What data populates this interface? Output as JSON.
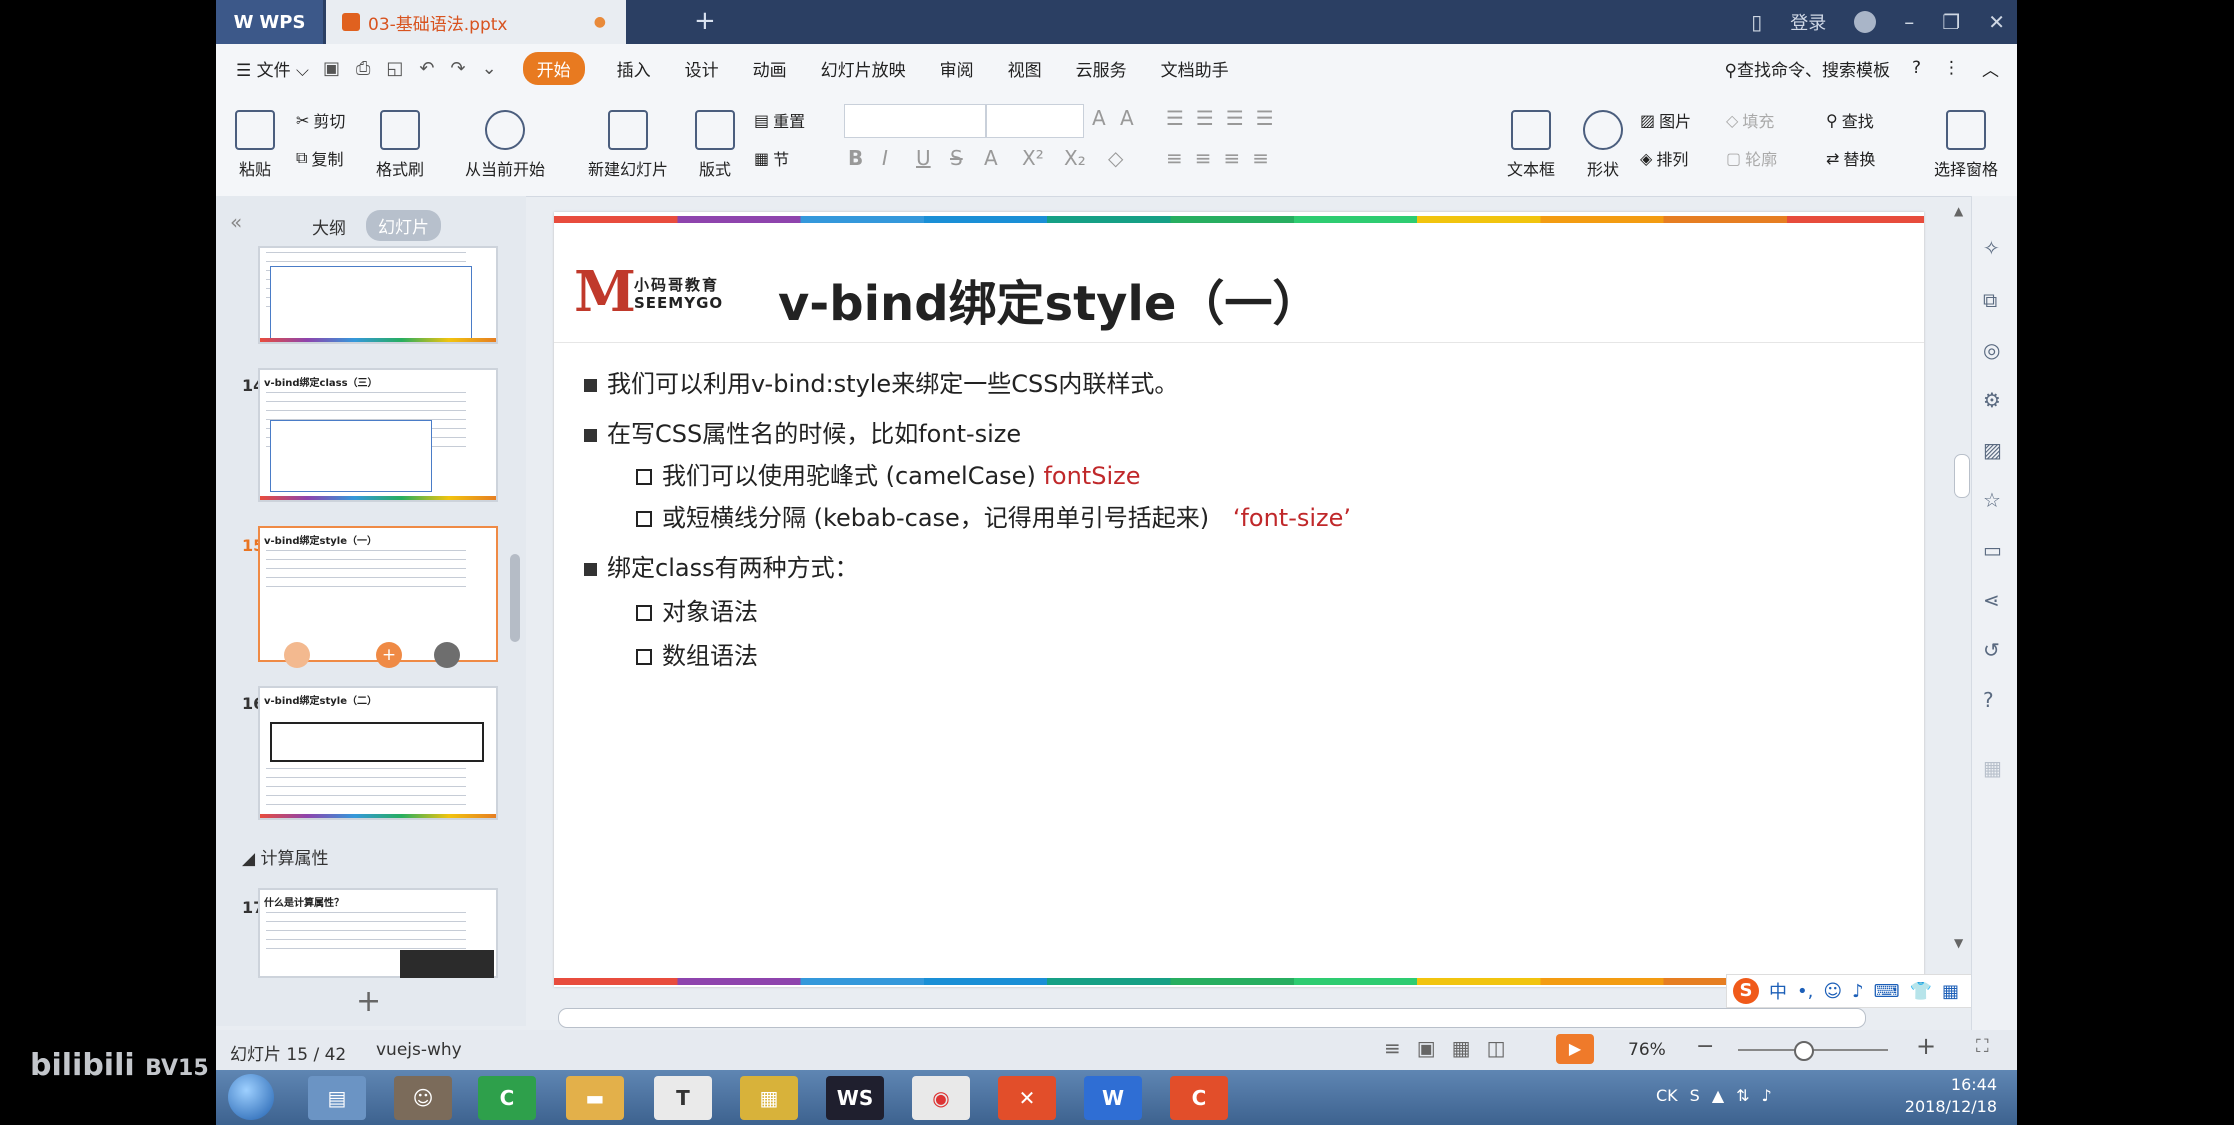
{
  "titlebar": {
    "wps_label": "WPS",
    "doc_tab": "03-基础语法.pptx",
    "login": "登录",
    "new_tab": "+"
  },
  "menu": {
    "file": "文件",
    "items": [
      "开始",
      "插入",
      "设计",
      "动画",
      "幻灯片放映",
      "审阅",
      "视图",
      "云服务",
      "文档助手"
    ],
    "search": "查找命令、搜索模板",
    "help": "?"
  },
  "ribbon": {
    "paste": "粘贴",
    "cut": "剪切",
    "copy": "复制",
    "format_painter": "格式刷",
    "play_from_current": "从当前开始",
    "new_slide": "新建幻灯片",
    "layout": "版式",
    "reset": "重置",
    "section": "节",
    "textbox": "文本框",
    "shape": "形状",
    "picture": "图片",
    "arrange": "排列",
    "fill": "填充",
    "outline": "轮廓",
    "find": "查找",
    "replace": "替换",
    "select_pane": "选择窗格"
  },
  "nav": {
    "tab_outline": "大纲",
    "tab_slides": "幻灯片",
    "thumbs": [
      {
        "num": "14",
        "title": "v-bind绑定class（三）"
      },
      {
        "num": "15",
        "title": "v-bind绑定style（一）"
      },
      {
        "num": "16",
        "title": "v-bind绑定style（二）"
      },
      {
        "num": "17",
        "title": "什么是计算属性？"
      }
    ],
    "section_title": "计算属性",
    "add": "+"
  },
  "slide": {
    "logo_cn": "小码哥教育",
    "logo_en": "SEEMYGO",
    "title": "v-bind绑定style（一）",
    "b1": "我们可以利用v-bind:style来绑定一些CSS内联样式。",
    "b2": "在写CSS属性名的时候，比如font-size",
    "b2_1": "我们可以使用驼峰式 (camelCase)",
    "b2_1_red": "fontSize",
    "b2_2": "或短横线分隔 (kebab-case，记得用单引号括起来)",
    "b2_2_red": "‘font-size’",
    "b3": "绑定class有两种方式：",
    "b3_1": "对象语法",
    "b3_2": "数组语法"
  },
  "status": {
    "slide_count": "幻灯片 15 / 42",
    "theme": "vuejs-why",
    "zoom": "76%"
  },
  "ime": {
    "mode": "中"
  },
  "taskbar": {
    "time": "16:44",
    "date": "2018/12/18",
    "lang": "CK"
  },
  "watermark": {
    "text": "bilibili",
    "code": "BV15"
  },
  "colors": {
    "accent": "#e87a20",
    "title_bar": "#2b3f63",
    "red_text": "#c0282a"
  }
}
